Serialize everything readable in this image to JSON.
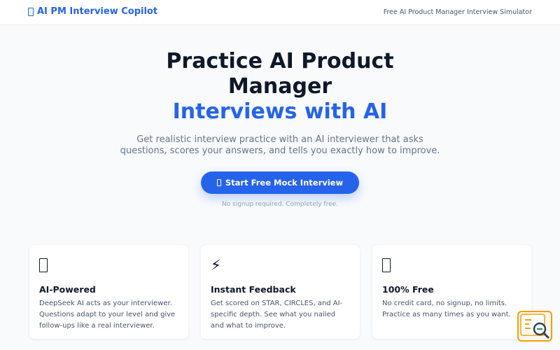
{
  "header": {
    "brand_label": "AI PM Interview Copilot",
    "tagline": "Free AI Product Manager Interview Simulator"
  },
  "hero": {
    "title_line1": "Practice AI Product",
    "title_line2": "Manager",
    "title_accent": "Interviews with AI",
    "subtitle": "Get realistic interview practice with an AI interviewer that asks questions, scores your answers, and tells you exactly how to improve.",
    "cta_label": "Start Free Mock Interview",
    "cta_note": "No signup required. Completely free."
  },
  "features": [
    {
      "icon": "box-icon",
      "title": "AI-Powered",
      "description": "DeepSeek AI acts as your interviewer. Questions adapt to your level and give follow-ups like a real interviewer."
    },
    {
      "icon": "lightning-icon",
      "icon_glyph": "⚡",
      "title": "Instant Feedback",
      "description": "Get scored on STAR, CIRCLES, and AI-specific depth. See what you nailed and what to improve."
    },
    {
      "icon": "box-icon",
      "title": "100% Free",
      "description": "No credit card, no signup, no limits. Practice as many times as you want."
    }
  ],
  "colors": {
    "accent": "#2563eb",
    "background": "#f8fafc",
    "widget_border": "#f59e0b"
  }
}
